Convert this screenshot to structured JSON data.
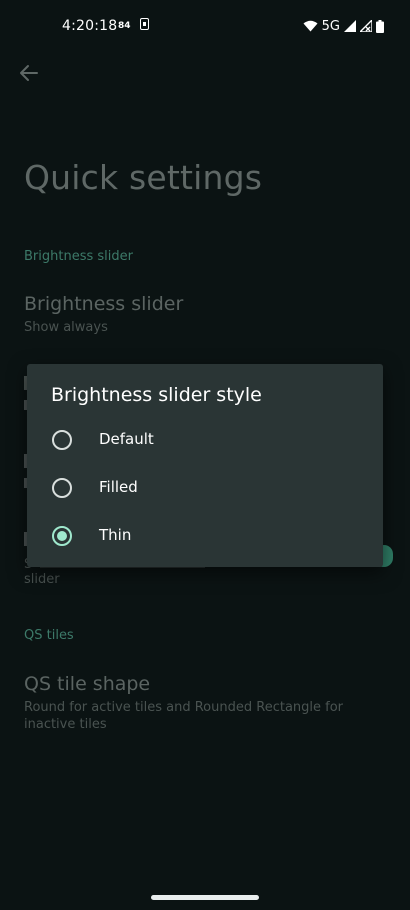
{
  "status_bar": {
    "time": "4:20:18",
    "indicator": "84",
    "network": "5G",
    "icons": [
      "sim-card-icon",
      "wifi-icon",
      "signal-icon",
      "signal-no-data-icon",
      "battery-icon"
    ]
  },
  "header": {
    "back_icon": "arrow-left-icon",
    "title": "Quick settings"
  },
  "sections": {
    "brightness_header": "Brightness slider",
    "brightness_title": "Brightness slider",
    "brightness_summary": "Show always",
    "hidden_summary_frag1": "S",
    "hidden_summary_frag2": "slider",
    "qs_header": "QS tiles",
    "qs_tile_title": "QS tile shape",
    "qs_tile_summary": "Round for active tiles and Rounded Rectangle for inactive tiles"
  },
  "dialog": {
    "title": "Brightness slider style",
    "options": [
      {
        "label": "Default",
        "checked": false
      },
      {
        "label": "Filled",
        "checked": false
      },
      {
        "label": "Thin",
        "checked": true
      }
    ]
  },
  "colors": {
    "background": "#0b1313",
    "dialog": "#2a3535",
    "accent": "#9fe8cd",
    "section_header": "#3d7a69"
  }
}
